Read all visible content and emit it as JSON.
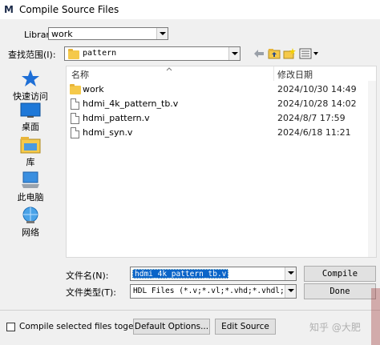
{
  "window": {
    "title": "Compile Source Files",
    "logo": "M"
  },
  "library": {
    "label": "Library:",
    "value": "work"
  },
  "lookin": {
    "label": "查找范围(I):",
    "value": "pattern"
  },
  "places": [
    {
      "label": "快速访问",
      "icon": "star-icon"
    },
    {
      "label": "桌面",
      "icon": "desktop-icon"
    },
    {
      "label": "库",
      "icon": "library-icon"
    },
    {
      "label": "此电脑",
      "icon": "computer-icon"
    },
    {
      "label": "网络",
      "icon": "network-icon"
    }
  ],
  "filelist": {
    "columns": {
      "name": "名称",
      "date": "修改日期"
    },
    "rows": [
      {
        "name": "work",
        "date": "2024/10/30 14:49",
        "type": "folder"
      },
      {
        "name": "hdmi_4k_pattern_tb.v",
        "date": "2024/10/28 14:02",
        "type": "file"
      },
      {
        "name": "hdmi_pattern.v",
        "date": "2024/8/7 17:59",
        "type": "file"
      },
      {
        "name": "hdmi_syn.v",
        "date": "2024/6/18 11:21",
        "type": "file"
      }
    ]
  },
  "filename": {
    "label": "文件名(N):",
    "value": "hdmi_4k_pattern_tb.v"
  },
  "filetype": {
    "label": "文件类型(T):",
    "value": "HDL Files (*.v;*.vl;*.vhd;*.vhdl;*.vh"
  },
  "buttons": {
    "compile": "Compile",
    "done": "Done",
    "default_options": "Default Options...",
    "edit_source": "Edit Source"
  },
  "checkbox": {
    "label": "Compile selected files together",
    "checked": false
  },
  "watermark": "知乎 @大肥"
}
